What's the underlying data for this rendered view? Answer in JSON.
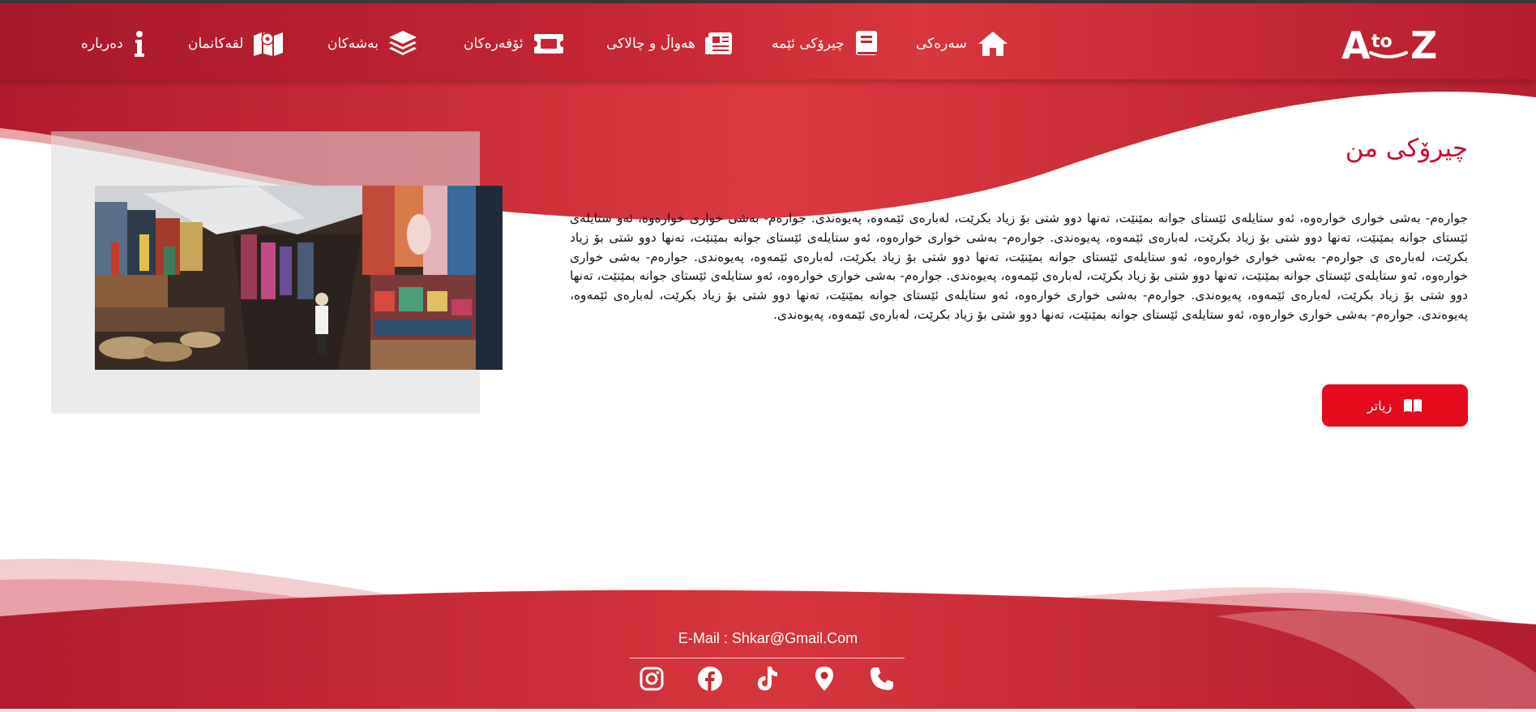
{
  "brand": {
    "logo_text": "AtoZ"
  },
  "nav": {
    "items": [
      {
        "label": "سەرەکی",
        "icon": "home-icon"
      },
      {
        "label": "چیرۆکی ئێمە",
        "icon": "book-icon"
      },
      {
        "label": "هەواڵ و چالاکی",
        "icon": "newspaper-icon"
      },
      {
        "label": "ئۆفەرەکان",
        "icon": "ticket-icon"
      },
      {
        "label": "بەشەکان",
        "icon": "layers-icon"
      },
      {
        "label": "لقەکانمان",
        "icon": "map-icon"
      },
      {
        "label": "دەربارە",
        "icon": "info-icon"
      }
    ]
  },
  "main": {
    "title": "چیرۆکی من",
    "paragraph": "جوارەم- بەشی خواری خوارەوە، ئەو ستایلەی ئێستای جوانە بمێنێت، تەنها دوو شتی بۆ زیاد بکرێت، لەبارەی ئێمەوە، پەیوەندی. جوارەم- بەشی خواری خوارەوە، ئەو ستایلەی ئێستای جوانە بمێنێت، تەنها دوو شتی بۆ زیاد بکرێت، لەبارەی ئێمەوە، پەیوەندی. جوارەم- بەشی خواری خوارەوە، ئەو ستایلەی ئێستای جوانە بمێنێت، تەنها دوو شتی بۆ زیاد بکرێت، لەبارەی ی جوارەم- بەشی خواری خوارەوە، ئەو ستایلەی ئێستای جوانە بمێنێت، تەنها دوو شتی بۆ زیاد بکرێت، لەبارەی ئێمەوە، پەیوەندی. جوارەم- بەشی خواری خوارەوە، ئەو ستایلەی ئێستای جوانە بمێنێت، تەنها دوو شتی بۆ زیاد بکرێت، لەبارەی ئێمەوە، پەیوەندی. جوارەم- بەشی خواری خوارەوە، ئەو ستایلەی ئێستای جوانە بمێنێت، تەنها دوو شتی بۆ زیاد بکرێت، لەبارەی ئێمەوە، پەیوەندی. جوارەم- بەشی خواری خوارەوە، ئەو ستایلەی ئێستای جوانە بمێنێت، تەنها دوو شتی بۆ زیاد بکرێت، لەبارەی ئێمەوە، پەیوەندی. جوارەم- بەشی خواری خوارەوە، ئەو ستایلەی ئێستای جوانە بمێنێت، تەنها دوو شتی بۆ زیاد بکرێت، لەبارەی ئێمەوە، پەیوەندی.",
    "button_label": "زیاتر",
    "button_icon": "open-book-icon",
    "image_description": "market-photo"
  },
  "footer": {
    "email": "E-Mail : Shkar@Gmail.Com",
    "social": [
      "instagram-icon",
      "facebook-icon",
      "tiktok-icon",
      "location-pin-icon",
      "phone-icon"
    ]
  },
  "colors": {
    "primary": "#c52633",
    "dark_red": "#a8182a",
    "button": "#e30b1c",
    "title": "#c8102e"
  }
}
